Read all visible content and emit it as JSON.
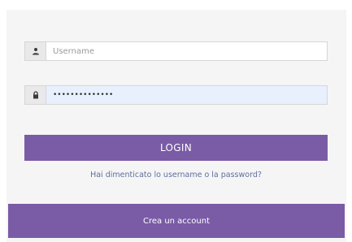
{
  "login_form": {
    "username": {
      "icon": "user-icon",
      "placeholder": "Username",
      "value": ""
    },
    "password": {
      "icon": "lock-icon",
      "value": "••••••••••••••"
    },
    "login_label": "LOGIN",
    "forgot_label": "Hai dimenticato lo username o la password?",
    "create_account_label": "Crea un account"
  },
  "colors": {
    "accent": "#7a5ba6",
    "link": "#5f6ea0",
    "panel_background": "#f5f5f5",
    "autofill_background": "#e8f0fe"
  }
}
